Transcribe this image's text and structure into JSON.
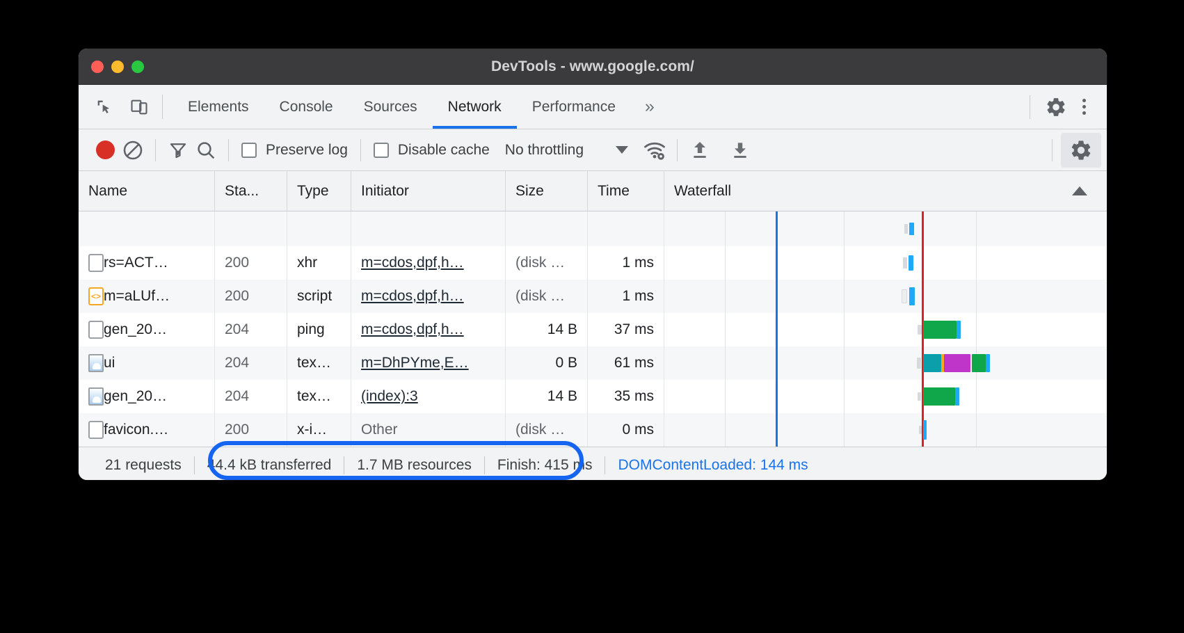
{
  "window": {
    "title": "DevTools - www.google.com/",
    "traffic_lights": [
      "close-red",
      "minimize-yellow",
      "maximize-green"
    ]
  },
  "tabbar": {
    "left_icons": [
      {
        "name": "inspect-element-icon"
      },
      {
        "name": "device-toolbar-icon"
      }
    ],
    "tabs": [
      {
        "label": "Elements",
        "active": false
      },
      {
        "label": "Console",
        "active": false
      },
      {
        "label": "Sources",
        "active": false
      },
      {
        "label": "Network",
        "active": true
      },
      {
        "label": "Performance",
        "active": false
      }
    ],
    "more_label": "»",
    "right_icons": [
      {
        "name": "settings-gear-icon"
      },
      {
        "name": "more-options-kebab-icon"
      }
    ]
  },
  "network_toolbar": {
    "record_button": {
      "name": "record-button",
      "state": "recording"
    },
    "clear_button": {
      "name": "clear-button"
    },
    "filter_button": {
      "name": "filter-icon"
    },
    "search_button": {
      "name": "search-icon"
    },
    "preserve_log": {
      "label": "Preserve log",
      "checked": false
    },
    "disable_cache": {
      "label": "Disable cache",
      "checked": false
    },
    "throttling": {
      "value": "No throttling"
    },
    "network_conditions_icon": "wifi-settings-icon",
    "import_har_icon": "upload-arrow-icon",
    "export_har_icon": "download-arrow-icon",
    "settings_icon": "network-settings-gear-icon"
  },
  "table": {
    "columns": [
      {
        "key": "name",
        "label": "Name"
      },
      {
        "key": "status",
        "label": "Sta..."
      },
      {
        "key": "type",
        "label": "Type"
      },
      {
        "key": "initiator",
        "label": "Initiator"
      },
      {
        "key": "size",
        "label": "Size"
      },
      {
        "key": "time",
        "label": "Time"
      },
      {
        "key": "waterfall",
        "label": "Waterfall"
      }
    ],
    "sort_indicator": "sort-ascending-triangle",
    "rows": [
      {
        "icon": "document-icon",
        "name": "rs=ACT…",
        "status": "200",
        "type": "xhr",
        "initiator": "m=cdos,dpf,h…",
        "size": "(disk …",
        "time": "1 ms"
      },
      {
        "icon": "script-icon",
        "name": "m=aLUf…",
        "status": "200",
        "type": "script",
        "initiator": "m=cdos,dpf,h…",
        "size": "(disk …",
        "time": "1 ms"
      },
      {
        "icon": "document-icon",
        "name": "gen_20…",
        "status": "204",
        "type": "ping",
        "initiator": "m=cdos,dpf,h…",
        "size": "14 B",
        "time": "37 ms"
      },
      {
        "icon": "image-icon",
        "name": "ui",
        "status": "204",
        "type": "tex…",
        "initiator": "m=DhPYme,E…",
        "size": "0 B",
        "time": "61 ms"
      },
      {
        "icon": "image-icon",
        "name": "gen_20…",
        "status": "204",
        "type": "tex…",
        "initiator": "(index):3",
        "size": "14 B",
        "time": "35 ms"
      },
      {
        "icon": "document-icon",
        "name": "favicon.…",
        "status": "200",
        "type": "x-i…",
        "initiator": "Other",
        "size": "(disk …",
        "time": "0 ms"
      }
    ]
  },
  "waterfall": {
    "dom_content_loaded_marker_color": "#1a73e8",
    "load_marker_color": "#e02020"
  },
  "statusbar": {
    "requests": "21 requests",
    "transferred": "44.4 kB transferred",
    "resources": "1.7 MB resources",
    "finish": "Finish: 415 ms",
    "dom_content_loaded": "DOMContentLoaded: 144 ms",
    "highlight_color": "#1565f0"
  }
}
